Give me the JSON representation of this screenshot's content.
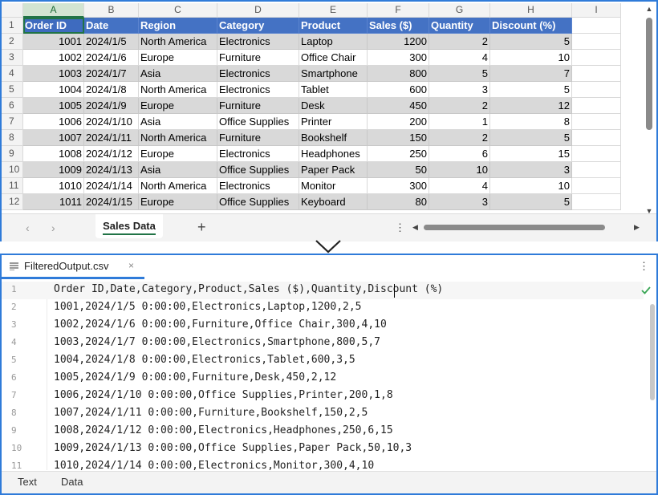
{
  "spreadsheet": {
    "column_letters": [
      "A",
      "B",
      "C",
      "D",
      "E",
      "F",
      "G",
      "H",
      "I"
    ],
    "selected_column": "A",
    "active_cell": "A1",
    "header_row_number": "1",
    "headers": [
      "Order ID",
      "Date",
      "Region",
      "Category",
      "Product",
      "Sales ($)",
      "Quantity",
      "Discount (%)"
    ],
    "rows": [
      {
        "num": "2",
        "cells": [
          "1001",
          "2024/1/5",
          "North America",
          "Electronics",
          "Laptop",
          "1200",
          "2",
          "5"
        ]
      },
      {
        "num": "3",
        "cells": [
          "1002",
          "2024/1/6",
          "Europe",
          "Furniture",
          "Office Chair",
          "300",
          "4",
          "10"
        ]
      },
      {
        "num": "4",
        "cells": [
          "1003",
          "2024/1/7",
          "Asia",
          "Electronics",
          "Smartphone",
          "800",
          "5",
          "7"
        ]
      },
      {
        "num": "5",
        "cells": [
          "1004",
          "2024/1/8",
          "North America",
          "Electronics",
          "Tablet",
          "600",
          "3",
          "5"
        ]
      },
      {
        "num": "6",
        "cells": [
          "1005",
          "2024/1/9",
          "Europe",
          "Furniture",
          "Desk",
          "450",
          "2",
          "12"
        ]
      },
      {
        "num": "7",
        "cells": [
          "1006",
          "2024/1/10",
          "Asia",
          "Office Supplies",
          "Printer",
          "200",
          "1",
          "8"
        ]
      },
      {
        "num": "8",
        "cells": [
          "1007",
          "2024/1/11",
          "North America",
          "Furniture",
          "Bookshelf",
          "150",
          "2",
          "5"
        ]
      },
      {
        "num": "9",
        "cells": [
          "1008",
          "2024/1/12",
          "Europe",
          "Electronics",
          "Headphones",
          "250",
          "6",
          "15"
        ]
      },
      {
        "num": "10",
        "cells": [
          "1009",
          "2024/1/13",
          "Asia",
          "Office Supplies",
          "Paper Pack",
          "50",
          "10",
          "3"
        ]
      },
      {
        "num": "11",
        "cells": [
          "1010",
          "2024/1/14",
          "North America",
          "Electronics",
          "Monitor",
          "300",
          "4",
          "10"
        ]
      },
      {
        "num": "12",
        "cells": [
          "1011",
          "2024/1/15",
          "Europe",
          "Office Supplies",
          "Keyboard",
          "80",
          "3",
          "5"
        ]
      }
    ],
    "sheet_tab": "Sales Data",
    "add_sheet_label": "+",
    "nav_prev": "‹",
    "nav_next": "›",
    "more_label": "⋮",
    "colors": {
      "header_fill": "#4472c4",
      "stripe_fill": "#d9d9d9",
      "accent": "#217346",
      "panel_border": "#2f7bd9"
    }
  },
  "editor": {
    "file_name": "FilteredOutput.csv",
    "close_label": "×",
    "menu_label": "⋮",
    "lines": [
      {
        "num": "1",
        "text": "Order ID,Date,Category,Product,Sales ($),Quantity,Discount (%)"
      },
      {
        "num": "2",
        "text": "1001,2024/1/5 0:00:00,Electronics,Laptop,1200,2,5"
      },
      {
        "num": "3",
        "text": "1002,2024/1/6 0:00:00,Furniture,Office Chair,300,4,10"
      },
      {
        "num": "4",
        "text": "1003,2024/1/7 0:00:00,Electronics,Smartphone,800,5,7"
      },
      {
        "num": "5",
        "text": "1004,2024/1/8 0:00:00,Electronics,Tablet,600,3,5"
      },
      {
        "num": "6",
        "text": "1005,2024/1/9 0:00:00,Furniture,Desk,450,2,12"
      },
      {
        "num": "7",
        "text": "1006,2024/1/10 0:00:00,Office Supplies,Printer,200,1,8"
      },
      {
        "num": "8",
        "text": "1007,2024/1/11 0:00:00,Furniture,Bookshelf,150,2,5"
      },
      {
        "num": "9",
        "text": "1008,2024/1/12 0:00:00,Electronics,Headphones,250,6,15"
      },
      {
        "num": "10",
        "text": "1009,2024/1/13 0:00:00,Office Supplies,Paper Pack,50,10,3"
      },
      {
        "num": "11",
        "text": "1010,2024/1/14 0:00:00,Electronics,Monitor,300,4,10"
      }
    ],
    "bottom_tabs": [
      "Text",
      "Data"
    ],
    "status_icon": "check-icon",
    "colors": {
      "check": "#3aa655",
      "accent": "#2f7bd9"
    }
  }
}
